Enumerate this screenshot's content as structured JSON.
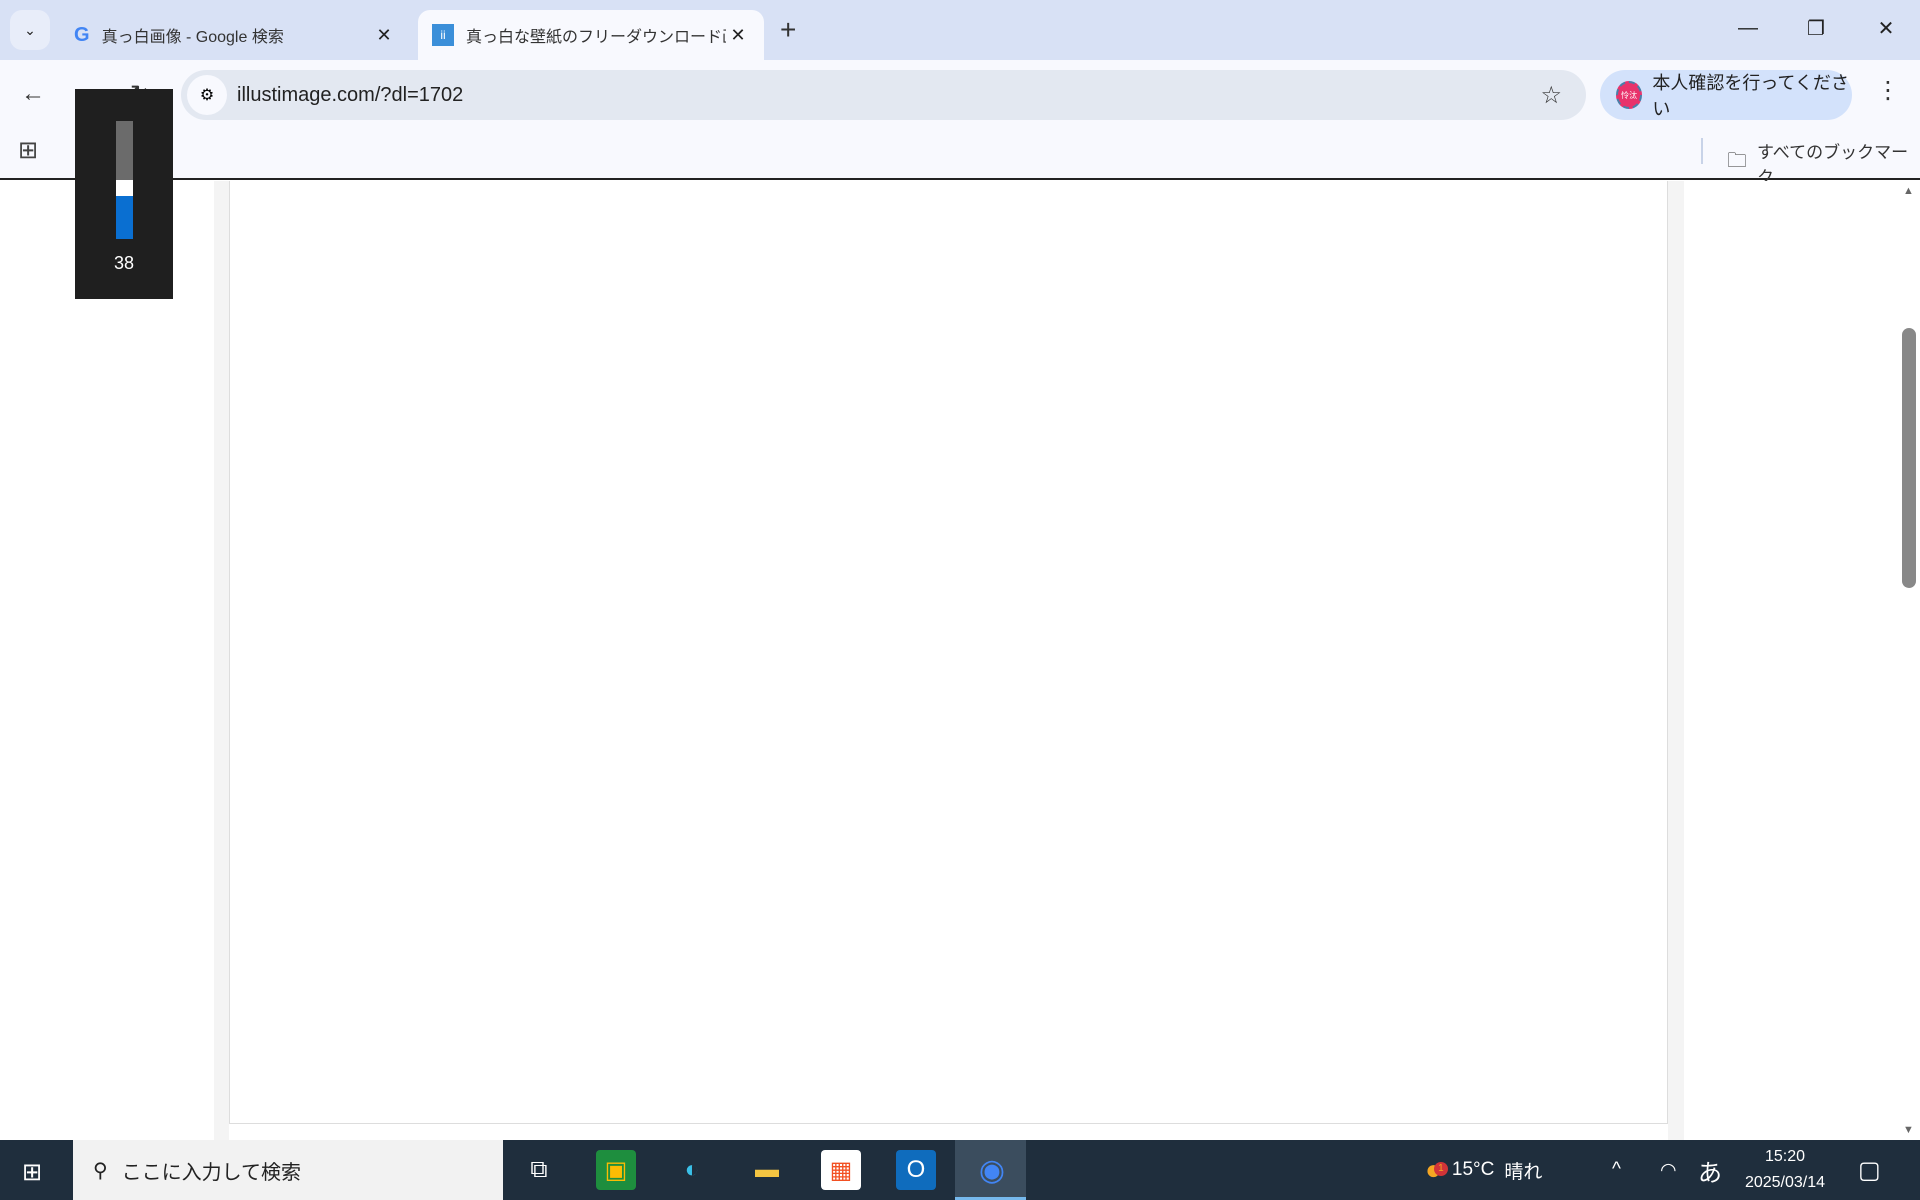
{
  "browser": {
    "tabs": [
      {
        "title": "真っ白画像 - Google 検索",
        "icon": "google-icon",
        "active": false
      },
      {
        "title": "真っ白な壁紙のフリーダウンロード画像",
        "icon": "illustimage-icon",
        "active": true
      }
    ],
    "url": "illustimage.com/?dl=1702",
    "profile_label": "本人確認を行ってください",
    "avatar_text": "怜汰",
    "bookmarks_label": "すべてのブックマーク"
  },
  "volume_overlay": {
    "level": 38,
    "label": "38"
  },
  "taskbar": {
    "search_placeholder": "ここに入力して検索",
    "apps": [
      "task-view",
      "google-classroom",
      "edge",
      "file-explorer",
      "microsoft-store",
      "outlook",
      "chrome"
    ],
    "weather_temp": "15°C",
    "weather_text": "晴れ",
    "weather_badge": "1",
    "ime": "あ",
    "time": "15:20",
    "date": "2025/03/14"
  },
  "colors": {
    "accent": "#0a6fd1",
    "tabbar": "#d8e1f5",
    "taskbar": "#1f2e3d"
  }
}
